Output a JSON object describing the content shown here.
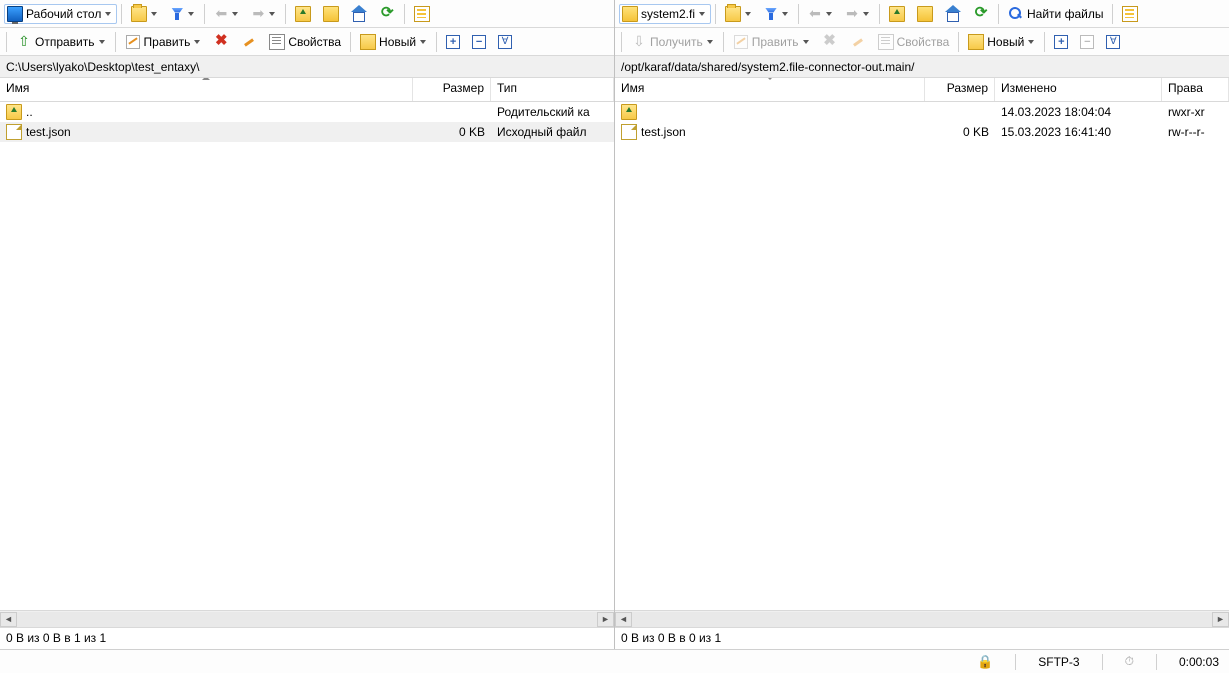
{
  "left": {
    "location": "Рабочий стол",
    "path": "C:\\Users\\lyako\\Desktop\\test_entaxy\\",
    "columns": {
      "name": "Имя",
      "size": "Размер",
      "type": "Тип"
    },
    "col_widths": {
      "name": 413,
      "size": 78,
      "type": 123
    },
    "sort_col": "name",
    "sort_dir": "asc",
    "rows": [
      {
        "icon": "folder-up",
        "name": "..",
        "size": "",
        "type": "Родительский ка",
        "selected": false
      },
      {
        "icon": "file",
        "name": "test.json",
        "size": "0 KB",
        "type": "Исходный файл",
        "selected": true
      }
    ],
    "summary": "0 B из 0 B в 1 из 1",
    "toolbar2": {
      "send": "Отправить",
      "edit": "Править",
      "props": "Свойства",
      "new": "Новый"
    }
  },
  "right": {
    "location": "system2.fi",
    "find": "Найти файлы",
    "path": "/opt/karaf/data/shared/system2.file-connector-out.main/",
    "columns": {
      "name": "Имя",
      "size": "Размер",
      "changed": "Изменено",
      "rights": "Права"
    },
    "col_widths": {
      "name": 310,
      "size": 70,
      "changed": 167,
      "rights": 68
    },
    "sort_col": "name",
    "sort_dir": "desc",
    "rows": [
      {
        "icon": "folder-up",
        "name": "",
        "size": "",
        "changed": "14.03.2023 18:04:04",
        "rights": "rwxr-xr"
      },
      {
        "icon": "file",
        "name": "test.json",
        "size": "0 KB",
        "changed": "15.03.2023 16:41:40",
        "rights": "rw-r--r-"
      }
    ],
    "summary": "0 B из 0 B в 0 из 1",
    "toolbar2": {
      "recv": "Получить",
      "edit": "Править",
      "props": "Свойства",
      "new": "Новый"
    }
  },
  "status": {
    "protocol": "SFTP-3",
    "time": "0:00:03"
  }
}
